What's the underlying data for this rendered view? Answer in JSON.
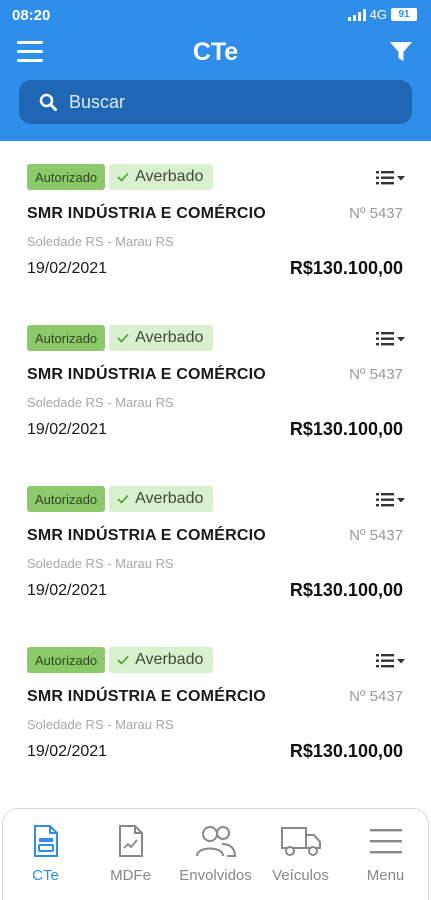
{
  "status_bar": {
    "time": "08:20",
    "network": "4G",
    "battery": "91"
  },
  "header": {
    "title": "CTe"
  },
  "search": {
    "placeholder": "Buscar"
  },
  "cards": [
    {
      "status": "Autorizado",
      "averbacao": "Averbado",
      "company": "SMR INDÚSTRIA E COMÉRCIO",
      "number": "Nº 5437",
      "route": "Soledade RS - Marau RS",
      "date": "19/02/2021",
      "amount": "R$130.100,00"
    },
    {
      "status": "Autorizado",
      "averbacao": "Averbado",
      "company": "SMR INDÚSTRIA E COMÉRCIO",
      "number": "Nº 5437",
      "route": "Soledade RS - Marau RS",
      "date": "19/02/2021",
      "amount": "R$130.100,00"
    },
    {
      "status": "Autorizado",
      "averbacao": "Averbado",
      "company": "SMR INDÚSTRIA E COMÉRCIO",
      "number": "Nº 5437",
      "route": "Soledade RS - Marau RS",
      "date": "19/02/2021",
      "amount": "R$130.100,00"
    },
    {
      "status": "Autorizado",
      "averbacao": "Averbado",
      "company": "SMR INDÚSTRIA E COMÉRCIO",
      "number": "Nº 5437",
      "route": "Soledade RS - Marau RS",
      "date": "19/02/2021",
      "amount": "R$130.100,00"
    }
  ],
  "bottom_nav": {
    "items": [
      {
        "label": "CTe",
        "icon": "cte-document-icon",
        "active": true
      },
      {
        "label": "MDFe",
        "icon": "mdfe-document-icon",
        "active": false
      },
      {
        "label": "Envolvidos",
        "icon": "people-icon",
        "active": false
      },
      {
        "label": "Veículos",
        "icon": "truck-icon",
        "active": false
      },
      {
        "label": "Menu",
        "icon": "hamburger-menu-icon",
        "active": false
      }
    ]
  },
  "colors": {
    "primary": "#2f8eea",
    "search_bg": "#1f67b5",
    "badge_autorizado": "#8bc96b",
    "badge_averbado": "#d9f0cf"
  }
}
